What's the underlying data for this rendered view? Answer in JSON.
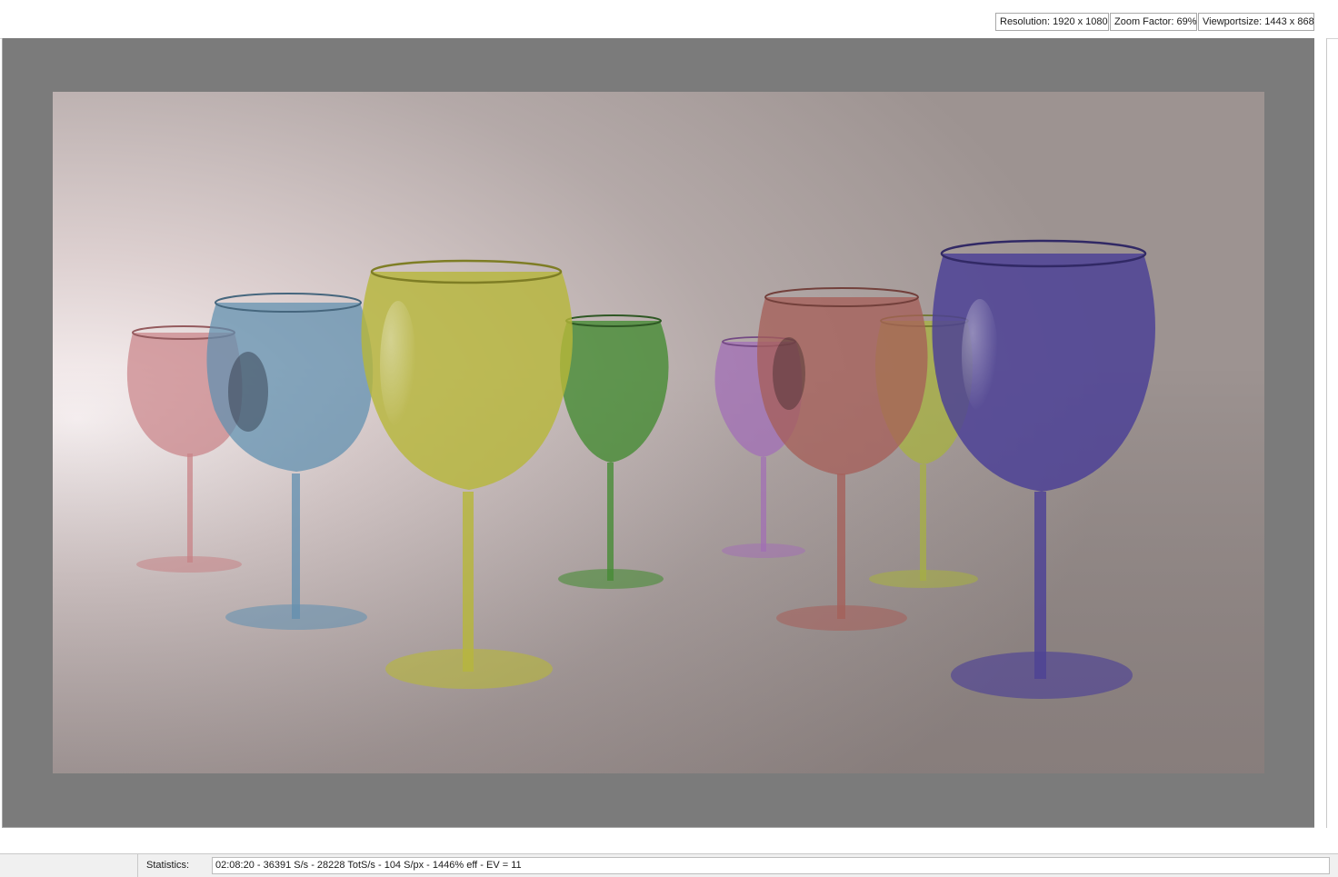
{
  "header": {
    "resolution": "Resolution: 1920 x 1080",
    "zoom_factor": "Zoom Factor: 69%",
    "viewport_size": "Viewportsize: 1443 x 868"
  },
  "status": {
    "label": "Statistics:",
    "value": "02:08:20 - 36391 S/s - 28228 TotS/s - 104 S/px - 1446% eff - EV = 11"
  },
  "render": {
    "background_color": "#a89e9b",
    "glass_colors": [
      "#c77d82",
      "#5f8fb0",
      "#b7b73a",
      "#3f8a2d",
      "#a26bb8",
      "#a65e58",
      "#a8b33c",
      "#4b3f96"
    ]
  }
}
